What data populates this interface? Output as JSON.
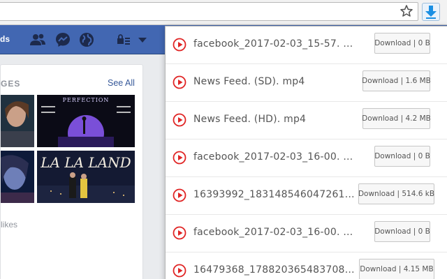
{
  "browser": {
    "star_icon": "star-outline-icon",
    "extension_icon": "download-arrow-icon",
    "accent": "#1a8fe3"
  },
  "facebook": {
    "nav_text_fragment": "ds",
    "header_color": "#4267b2",
    "icons": [
      "friends-icon",
      "messenger-icon",
      "globe-icon",
      "lock-menu-icon",
      "caret-down-icon"
    ],
    "pages_section": {
      "title_fragment": "GES",
      "see_all": "See All",
      "likes_fragment": "likes"
    }
  },
  "downloads": {
    "items": [
      {
        "name": "facebook_2017-02-03_15-57. …",
        "button": "Download | 0 B"
      },
      {
        "name": "News Feed. (SD). mp4",
        "button": "Download | 1.6 MB"
      },
      {
        "name": "News Feed. (HD). mp4",
        "button": "Download | 4.2 MB"
      },
      {
        "name": "facebook_2017-02-03_16-00. …",
        "button": "Download | 0 B"
      },
      {
        "name": "16393992_183148546047261…",
        "button": "Download | 514.6 kB"
      },
      {
        "name": "facebook_2017-02-03_16-00. …",
        "button": "Download | 0 B"
      },
      {
        "name": "16479368_178820365483708…",
        "button": "Download | 4.15 MB"
      }
    ],
    "play_icon_color": "#e02424"
  }
}
